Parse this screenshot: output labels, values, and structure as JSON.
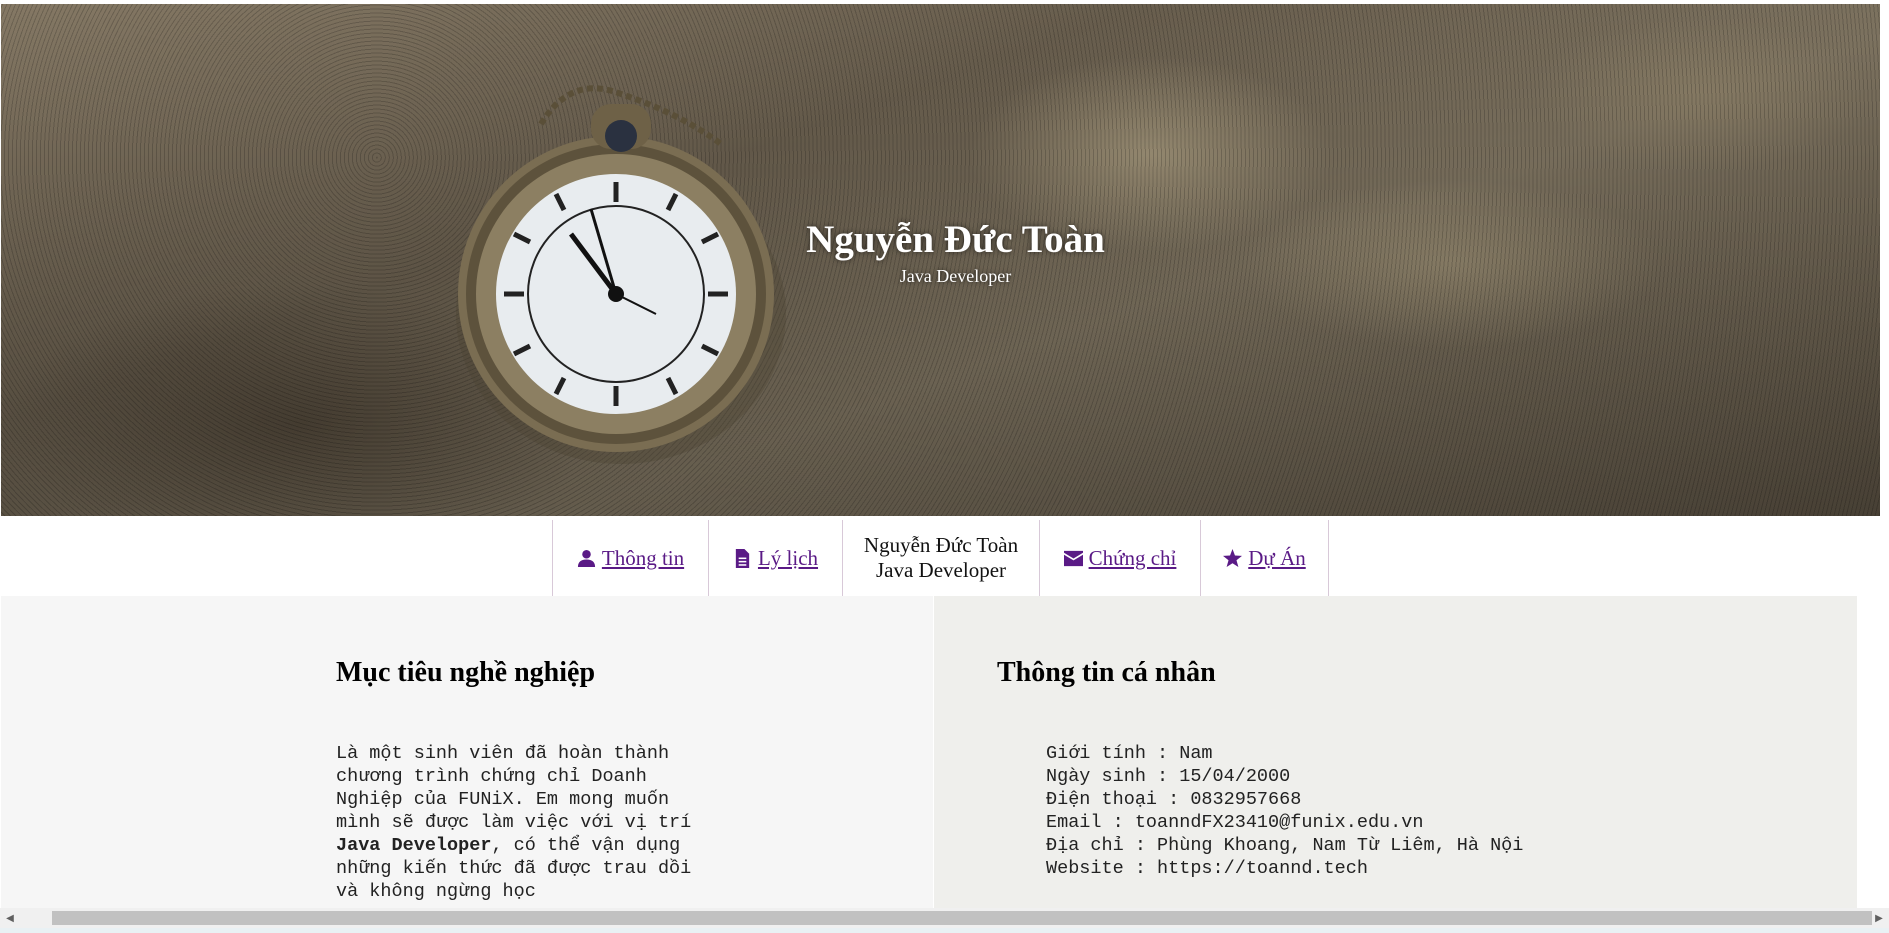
{
  "hero": {
    "name": "Nguyễn Đức Toàn",
    "role": "Java Developer"
  },
  "nav": {
    "items": [
      {
        "label": "Thông tin",
        "icon": "user-icon"
      },
      {
        "label": "Lý lịch",
        "icon": "file-icon"
      },
      {
        "label": "Chứng chỉ",
        "icon": "envelope-icon"
      },
      {
        "label": "Dự Án",
        "icon": "star-icon"
      }
    ],
    "center_name": "Nguyễn Đức Toàn",
    "center_role": "Java Developer"
  },
  "career": {
    "title": "Mục tiêu nghề nghiệp",
    "text_before": "Là một sinh viên đã hoàn thành chương trình chứng chỉ Doanh Nghiệp của FUNiX. Em mong muốn mình sẽ được làm việc với vị trí ",
    "text_bold": "Java Developer",
    "text_after": ", có thể vận dụng những kiến thức đã được trau dồi và không ngừng học"
  },
  "personal": {
    "title": "Thông tin cá nhân",
    "rows": [
      "Giới tính : Nam",
      "Ngày sinh : 15/04/2000",
      "Điện thoại : 0832957668",
      "Email : toanndFX23410@funix.edu.vn",
      "Địa chỉ : Phùng Khoang, Nam Từ Liêm, Hà Nội",
      "Website : https://toannd.tech"
    ]
  },
  "colors": {
    "link": "#5a1a86",
    "left_panel": "#f6f6f6",
    "right_panel": "#efefec"
  }
}
